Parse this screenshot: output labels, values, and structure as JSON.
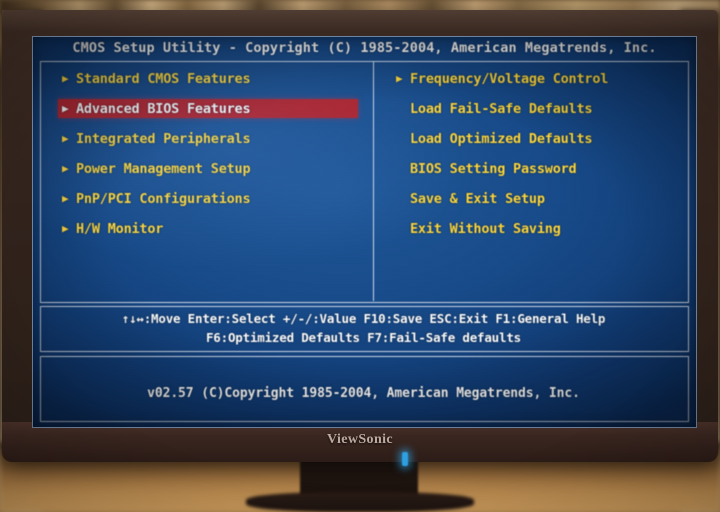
{
  "monitor": {
    "brand": "ViewSonic"
  },
  "bios": {
    "title": "CMOS Setup Utility - Copyright (C) 1985-2004, American Megatrends, Inc.",
    "left_menu": [
      {
        "label": "Standard CMOS Features",
        "arrow": "▶",
        "selected": false
      },
      {
        "label": "Advanced BIOS Features",
        "arrow": "▶",
        "selected": true
      },
      {
        "label": "Integrated Peripherals",
        "arrow": "▶",
        "selected": false
      },
      {
        "label": "Power Management Setup",
        "arrow": "▶",
        "selected": false
      },
      {
        "label": "PnP/PCI Configurations",
        "arrow": "▶",
        "selected": false
      },
      {
        "label": "H/W Monitor",
        "arrow": "▶",
        "selected": false
      }
    ],
    "right_menu": [
      {
        "label": "Frequency/Voltage Control",
        "arrow": "▶",
        "has_arrow": true,
        "selected": false
      },
      {
        "label": "Load Fail-Safe Defaults",
        "arrow": "",
        "has_arrow": false,
        "selected": false
      },
      {
        "label": "Load Optimized Defaults",
        "arrow": "",
        "has_arrow": false,
        "selected": false
      },
      {
        "label": "BIOS Setting Password",
        "arrow": "",
        "has_arrow": false,
        "selected": false
      },
      {
        "label": "Save & Exit Setup",
        "arrow": "",
        "has_arrow": false,
        "selected": false
      },
      {
        "label": "Exit Without Saving",
        "arrow": "",
        "has_arrow": false,
        "selected": false
      }
    ],
    "help_line_1": "↑↓↔:Move   Enter:Select   +/-/:Value   F10:Save   ESC:Exit   F1:General Help",
    "help_line_2": "F6:Optimized Defaults                    F7:Fail-Safe defaults",
    "version": "v02.57 (C)Copyright 1985-2004, American Megatrends, Inc."
  },
  "colors": {
    "screen_blue": "#164a8a",
    "menu_yellow": "#ffd83a",
    "highlight_red": "#b01f28",
    "text_white": "#ffffff",
    "border": "#cfd9ea"
  }
}
